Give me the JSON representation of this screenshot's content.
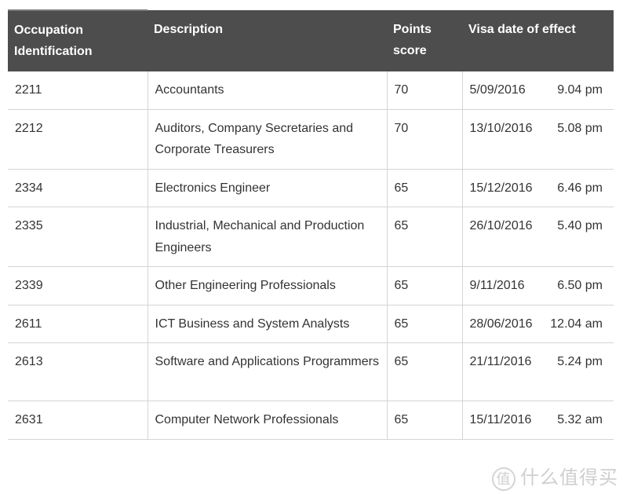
{
  "table": {
    "headers": [
      "Occupation Identification",
      "Description",
      "Points score",
      "Visa date of effect"
    ],
    "header_bg": "#4d4d4d",
    "rows": [
      {
        "id": "2211",
        "desc": "Accountants",
        "points": "70",
        "date": "5/09/2016",
        "time": "9.04 pm"
      },
      {
        "id": "2212",
        "desc": "Auditors, Company Secretaries and Corporate Treasurers",
        "points": "70",
        "date": "13/10/2016",
        "time": "5.08 pm"
      },
      {
        "id": "2334",
        "desc": "Electronics Engineer",
        "points": "65",
        "date": "15/12/2016",
        "time": "6.46 pm"
      },
      {
        "id": "2335",
        "desc": "Industrial, Mechanical and Production Engineers",
        "points": "65",
        "date": "26/10/2016",
        "time": "5.40 pm"
      },
      {
        "id": "2339",
        "desc": "Other Engineering Professionals",
        "points": "65",
        "date": "9/11/2016",
        "time": "6.50 pm"
      },
      {
        "id": "2611",
        "desc": "ICT Business and System Analysts",
        "points": "65",
        "date": "28/06/2016",
        "time": "12.04 am"
      },
      {
        "id": "2613",
        "desc": "Software and Applications Programmers",
        "points": "65",
        "date": "21/11/2016",
        "time": "5.24 pm"
      },
      {
        "id": "2631",
        "desc": "Computer Network Professionals",
        "points": "65",
        "date": "15/11/2016",
        "time": "5.32 am"
      }
    ]
  },
  "watermark": {
    "badge": "值",
    "text": "什么值得买"
  }
}
